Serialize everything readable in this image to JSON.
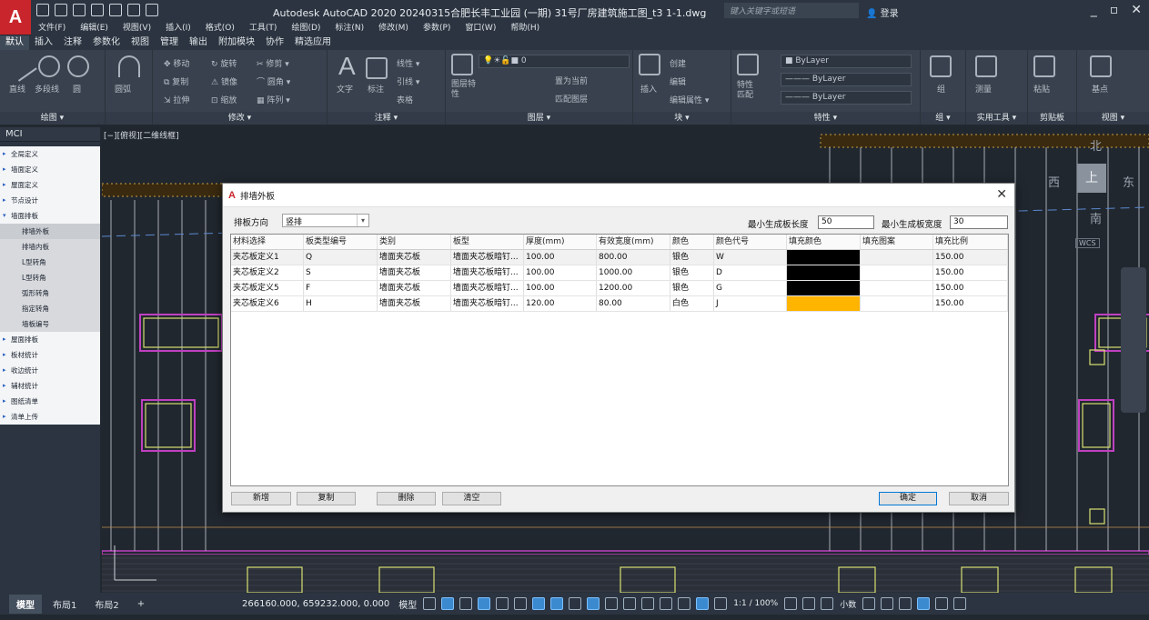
{
  "app": {
    "logo": "A",
    "title": "Autodesk AutoCAD 2020    20240315合肥长丰工业园 (一期) 31号厂房建筑施工图_t3 1-1.dwg",
    "search_placeholder": "键入关键字或短语",
    "login": "登录",
    "win_min": "_",
    "win_restore": "▫",
    "win_close": "✕"
  },
  "menu": [
    "文件(F)",
    "编辑(E)",
    "视图(V)",
    "插入(I)",
    "格式(O)",
    "工具(T)",
    "绘图(D)",
    "标注(N)",
    "修改(M)",
    "参数(P)",
    "窗口(W)",
    "帮助(H)"
  ],
  "ribbon_tabs": [
    "默认",
    "插入",
    "注释",
    "参数化",
    "视图",
    "管理",
    "输出",
    "附加模块",
    "协作",
    "精选应用"
  ],
  "ribbon": {
    "draw": {
      "title": "绘图 ▾",
      "line": "直线",
      "polyline": "多段线",
      "circle": "圆",
      "arc": "圆弧"
    },
    "modify": {
      "title": "修改 ▾",
      "move": "移动",
      "rotate": "旋转",
      "trim": "修剪 ▾",
      "copy": "复制",
      "mirror": "镜像",
      "fillet": "圆角 ▾",
      "stretch": "拉伸",
      "scale": "缩放",
      "array": "阵列 ▾"
    },
    "annotation": {
      "title": "注释 ▾",
      "text": "文字",
      "dimension": "标注",
      "linear": "线性 ▾",
      "leader": "引线 ▾",
      "table": "表格"
    },
    "layers": {
      "title": "图层 ▾",
      "layer_props": "图层特性",
      "current_layer": "0",
      "make_current": "置为当前",
      "match_layer": "匹配图层"
    },
    "block": {
      "title": "块 ▾",
      "insert": "插入",
      "create": "创建",
      "edit": "编辑",
      "edit_attr": "编辑属性 ▾"
    },
    "properties": {
      "title": "特性 ▾",
      "match": "特性匹配",
      "bylayer1": "ByLayer",
      "bylayer2": "——— ByLayer",
      "bylayer3": "——— ByLayer"
    },
    "groups": {
      "title": "组 ▾",
      "group": "组"
    },
    "utilities": {
      "title": "实用工具 ▾",
      "measure": "测量"
    },
    "clipboard": {
      "title": "剪贴板",
      "paste": "粘贴"
    },
    "view": {
      "title": "视图 ▾",
      "base": "基点"
    }
  },
  "palette": {
    "title": "MCI",
    "items": [
      {
        "label": "全局定义",
        "type": "top"
      },
      {
        "label": "墙面定义",
        "type": "top"
      },
      {
        "label": "屋面定义",
        "type": "top"
      },
      {
        "label": "节点设计",
        "type": "top"
      },
      {
        "label": "墙面排板",
        "type": "open"
      },
      {
        "label": "排墙外板",
        "type": "sub"
      },
      {
        "label": "排墙内板",
        "type": "sub"
      },
      {
        "label": "L型转角",
        "type": "sub"
      },
      {
        "label": "L型转角",
        "type": "sub"
      },
      {
        "label": "弧形转角",
        "type": "sub"
      },
      {
        "label": "指定转角",
        "type": "sub"
      },
      {
        "label": "墙板编号",
        "type": "sub"
      },
      {
        "label": "屋面排板",
        "type": "top"
      },
      {
        "label": "板材统计",
        "type": "top"
      },
      {
        "label": "收边统计",
        "type": "top"
      },
      {
        "label": "辅材统计",
        "type": "top"
      },
      {
        "label": "图纸清单",
        "type": "top"
      },
      {
        "label": "清单上传",
        "type": "top"
      }
    ]
  },
  "viewport": {
    "label": "[−][俯视][二维线框]"
  },
  "viewcube": {
    "north": "北",
    "south": "南",
    "east": "东",
    "west": "西",
    "top": "上",
    "wcs": "WCS"
  },
  "layout_tabs": [
    "模型",
    "布局1",
    "布局2",
    "+"
  ],
  "status": {
    "coords": "266160.000, 659232.000, 0.000",
    "model": "模型",
    "scale": "1:1 / 100%",
    "decimal": "小数"
  },
  "dialog": {
    "icon": "A",
    "title": "排墙外板",
    "close": "✕",
    "direction_label": "排板方向",
    "direction_value": "竖排",
    "min_len_label": "最小生成板长度",
    "min_len_value": "50",
    "min_wid_label": "最小生成板宽度",
    "min_wid_value": "30",
    "columns": [
      "材料选择",
      "板类型编号",
      "类别",
      "板型",
      "厚度(mm)",
      "有效宽度(mm)",
      "颜色",
      "颜色代号",
      "填充颜色",
      "填充图案",
      "填充比例"
    ],
    "rows": [
      {
        "material": "夹芯板定义1",
        "code": "Q",
        "category": "墙面夹芯板",
        "type": "墙面夹芯板暗钉...",
        "thickness": "100.00",
        "width": "800.00",
        "color": "银色",
        "color_code": "W",
        "fill_color": "#000000",
        "pattern": "",
        "ratio": "150.00"
      },
      {
        "material": "夹芯板定义2",
        "code": "S",
        "category": "墙面夹芯板",
        "type": "墙面夹芯板暗钉...",
        "thickness": "100.00",
        "width": "1000.00",
        "color": "银色",
        "color_code": "D",
        "fill_color": "#000000",
        "pattern": "",
        "ratio": "150.00"
      },
      {
        "material": "夹芯板定义5",
        "code": "F",
        "category": "墙面夹芯板",
        "type": "墙面夹芯板暗钉...",
        "thickness": "100.00",
        "width": "1200.00",
        "color": "银色",
        "color_code": "G",
        "fill_color": "#000000",
        "pattern": "",
        "ratio": "150.00"
      },
      {
        "material": "夹芯板定义6",
        "code": "H",
        "category": "墙面夹芯板",
        "type": "墙面夹芯板暗钉...",
        "thickness": "120.00",
        "width": "80.00",
        "color": "白色",
        "color_code": "J",
        "fill_color": "#ffb400",
        "pattern": "",
        "ratio": "150.00"
      }
    ],
    "buttons": {
      "new": "新增",
      "copy": "复制",
      "delete": "删除",
      "clear": "清空",
      "ok": "确定",
      "cancel": "取消"
    }
  },
  "colors": {
    "accent": "#c8262c",
    "drawing_bg": "#21272f",
    "window_frame": "#c040c0",
    "window_glass": "#d8e070"
  }
}
